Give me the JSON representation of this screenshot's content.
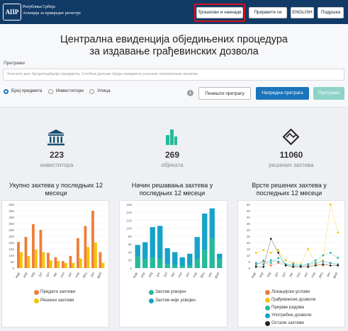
{
  "header": {
    "logo_text": "АПР",
    "org_line1": "Република Србија",
    "org_line2": "Агенција за привредне регистре",
    "buttons": [
      "Трошкови и накнаде",
      "Пријавите се",
      "ENGLISH",
      "Подршка"
    ]
  },
  "hero": {
    "title_line1": "Централна евиденција обједињених процедура",
    "title_line2": "за издавање грађевинских дозвола",
    "search_label": "Претражи",
    "search_placeholder": "Унесите део броја/подброја предмета. Слобни делове броја предмета унесите латиничним писмом.",
    "radios": [
      "Број предмета",
      "Инвеститори",
      "Улица"
    ],
    "selected_radio": "Број предмета",
    "reset_button": "Поништи претрагу",
    "advanced_button": "Напредна претрага",
    "search_button": "Претражи",
    "info_glyph": "i"
  },
  "stats": [
    {
      "value": "223",
      "label": "инвеститора",
      "icon": "bank-icon"
    },
    {
      "value": "269",
      "label": "објеката",
      "icon": "buildings-icon"
    },
    {
      "value": "11060",
      "label": "решених захтева",
      "icon": "layers-icon"
    }
  ],
  "colors": {
    "header_bg": "#123a66",
    "primary_button": "#1b75bc",
    "search_button": "#8fd3c8",
    "highlight": "#d4101c"
  },
  "chart_data": [
    {
      "type": "bar",
      "title": "Укупно захтева у последњих 12 месеци",
      "categories": [
        "мар",
        "апр",
        "мај",
        "јун",
        "јул",
        "авг",
        "сеп",
        "окт",
        "нов",
        "дец",
        "јан",
        "феб"
      ],
      "ylim": [
        0,
        500
      ],
      "yticks": [
        0,
        50,
        100,
        150,
        200,
        250,
        300,
        350,
        400,
        450,
        500
      ],
      "series": [
        {
          "name": "Предати захтеви",
          "color": "#ee7d3b",
          "values": [
            205,
            245,
            345,
            300,
            120,
            85,
            55,
            95,
            235,
            330,
            450,
            125
          ]
        },
        {
          "name": "Решени захтеви",
          "color": "#f5c400",
          "values": [
            125,
            95,
            145,
            125,
            60,
            55,
            40,
            40,
            75,
            165,
            200,
            40
          ]
        }
      ]
    },
    {
      "type": "bar",
      "stacked": true,
      "title": "Начин решавања захтева у последњих 12 месеци",
      "categories": [
        "мар",
        "апр",
        "мај",
        "јун",
        "јул",
        "авг",
        "сеп",
        "окт",
        "нов",
        "дец",
        "јан",
        "феб"
      ],
      "ylim": [
        0,
        160
      ],
      "yticks": [
        0,
        20,
        40,
        60,
        80,
        100,
        120,
        140,
        160
      ],
      "series": [
        {
          "name": "Захтев усвојен",
          "color": "#26b99a",
          "values": [
            28,
            22,
            26,
            24,
            10,
            8,
            5,
            6,
            23,
            45,
            75,
            24
          ]
        },
        {
          "name": "Захтев није усвојен",
          "color": "#17a2c8",
          "values": [
            30,
            43,
            77,
            82,
            40,
            32,
            22,
            30,
            55,
            92,
            75,
            12
          ]
        }
      ]
    },
    {
      "type": "line",
      "title": "Врсте решених захтева у последњих 12 месеци",
      "categories": [
        "мар",
        "апр",
        "мај",
        "јун",
        "јул",
        "авг",
        "сеп",
        "окт",
        "нов",
        "дец",
        "јан",
        "феб"
      ],
      "ylim": [
        0,
        50
      ],
      "yticks": [
        0,
        5,
        10,
        15,
        20,
        25,
        30,
        35,
        40,
        45,
        50
      ],
      "series": [
        {
          "name": "Локацијски услови",
          "color": "#ee7d3b",
          "values": [
            3,
            5,
            2,
            4,
            2,
            1,
            1,
            2,
            3,
            2,
            4,
            2
          ]
        },
        {
          "name": "Грађевинске дозволе",
          "color": "#f5c400",
          "values": [
            12,
            14,
            12,
            14,
            6,
            4,
            3,
            15,
            3,
            6,
            50,
            28
          ]
        },
        {
          "name": "Пријаве радова",
          "color": "#26b99a",
          "values": [
            2,
            6,
            4,
            8,
            3,
            2,
            2,
            3,
            6,
            10,
            12,
            8
          ]
        },
        {
          "name": "Употребне дозволе",
          "color": "#17a2c8",
          "values": [
            4,
            3,
            6,
            5,
            3,
            3,
            2,
            3,
            4,
            5,
            4,
            3
          ]
        },
        {
          "name": "Остали захтеви",
          "color": "#222222",
          "values": [
            1,
            1,
            23,
            12,
            2,
            1,
            1,
            1,
            2,
            3,
            2,
            2
          ]
        }
      ]
    }
  ]
}
